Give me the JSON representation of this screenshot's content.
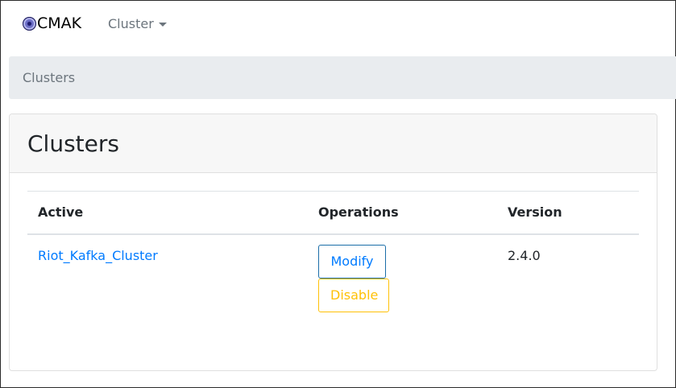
{
  "navbar": {
    "brand_label": "CMAK",
    "brand_icon": "cmak-logo-icon",
    "dropdown_label": "Cluster"
  },
  "breadcrumb": {
    "current": "Clusters"
  },
  "card": {
    "title": "Clusters"
  },
  "table": {
    "headers": {
      "active": "Active",
      "operations": "Operations",
      "version": "Version"
    },
    "rows": [
      {
        "name": "Riot_Kafka_Cluster",
        "modify_label": "Modify",
        "disable_label": "Disable",
        "version": "2.4.0"
      }
    ]
  },
  "colors": {
    "link": "#007bff",
    "warning": "#ffc107",
    "breadcrumb_bg": "#e9ecef",
    "muted": "#6c757d"
  }
}
